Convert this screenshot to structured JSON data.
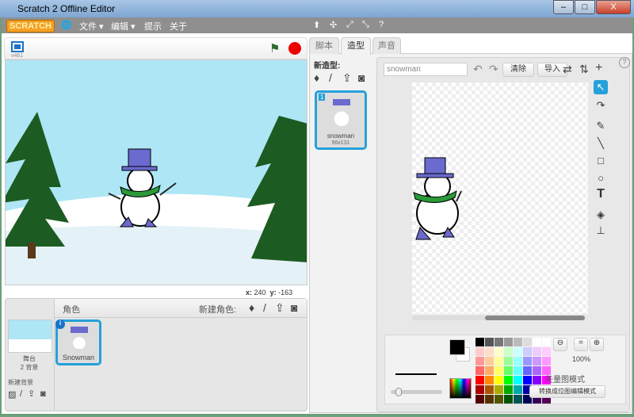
{
  "window": {
    "title": "Scratch 2 Offline Editor",
    "min": "–",
    "max": "□",
    "close": "X"
  },
  "menu": {
    "logo": "SCRATCH",
    "file": "文件 ▾",
    "edit": "编辑 ▾",
    "tips": "提示",
    "about": "关于",
    "globe_icon": "globe-icon",
    "help": "?"
  },
  "stage": {
    "version": "v461",
    "x_label": "x:",
    "x_value": "240",
    "y_label": "y:",
    "y_value": "-163"
  },
  "sprites": {
    "header": "角色",
    "new_sprite": "新建角色:",
    "stage_label": "舞台",
    "backdrops": "2 背景",
    "new_backdrop": "新建背景",
    "items": [
      {
        "name": "Snowman"
      }
    ]
  },
  "tabs": [
    {
      "label": "脚本"
    },
    {
      "label": "造型"
    },
    {
      "label": "声音"
    }
  ],
  "costumes": {
    "new_costume": "新造型:",
    "items": [
      {
        "index": "1",
        "name": "snowman",
        "size": "96x131"
      }
    ]
  },
  "paint": {
    "name_value": "snowman",
    "clear": "清除",
    "import": "导入",
    "zoom": "100%",
    "vector_mode": "矢量图模式",
    "convert": "转换成位图编辑模式",
    "help": "?"
  },
  "colors": {
    "accent": "#25a1d9",
    "stage_sky": "#aee6f5",
    "tree": "#1c5c22",
    "menubar": "#8f8f8f"
  }
}
